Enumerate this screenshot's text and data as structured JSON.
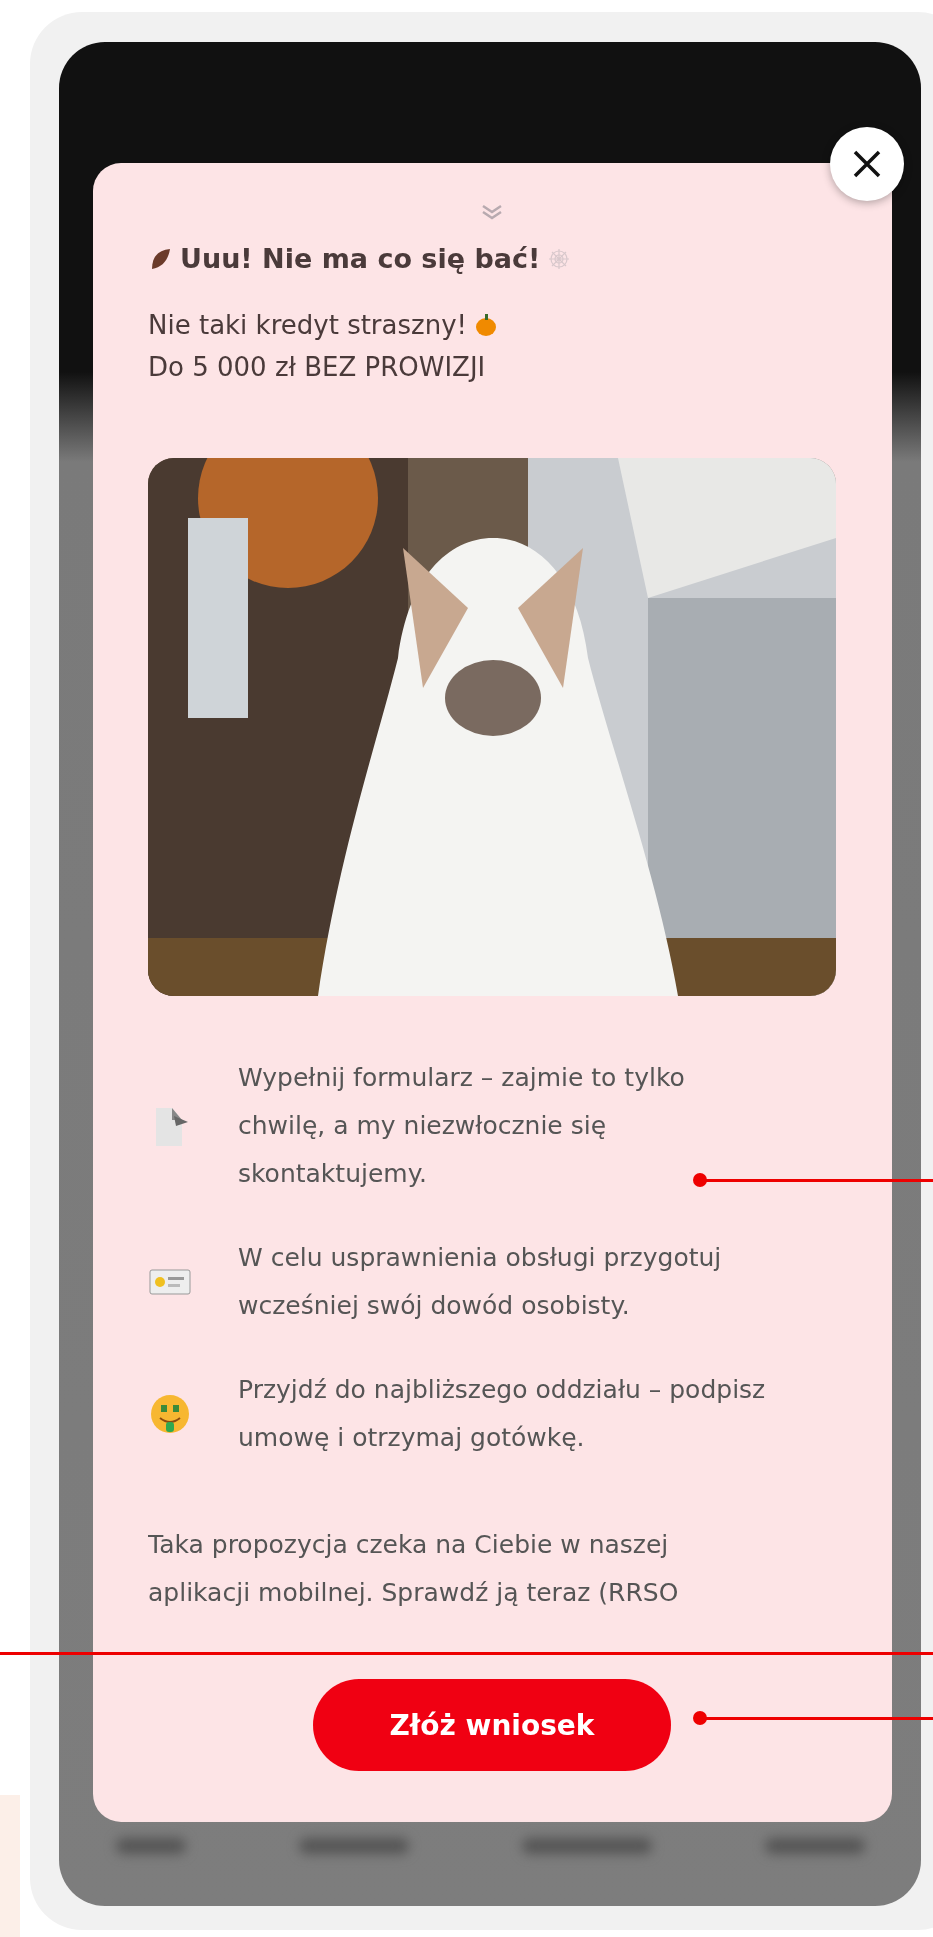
{
  "header": {
    "title": "Uuu! Nie ma co się bać!",
    "subtitle": "Nie taki kredyt straszny!",
    "offer": "Do 5 000 zł BEZ PROWIZJI"
  },
  "steps": [
    {
      "kind": "document",
      "text": "Wypełnij formularz – zajmie to tylko chwilę, a my niezwłocznie się skontaktujemy."
    },
    {
      "kind": "id_card",
      "text": "W celu usprawnienia obsługi przygotuj wcześniej swój dowód osobisty."
    },
    {
      "kind": "money_face",
      "text": "Przyjdź do najbliższego oddziału – podpisz umowę i otrzymaj gotówkę."
    }
  ],
  "note": "Taka propozycja czeka na Ciebie w naszej aplikacji mobilnej. Sprawdź ją teraz  (RRSO",
  "cta": {
    "label": "Złóż wniosek"
  }
}
